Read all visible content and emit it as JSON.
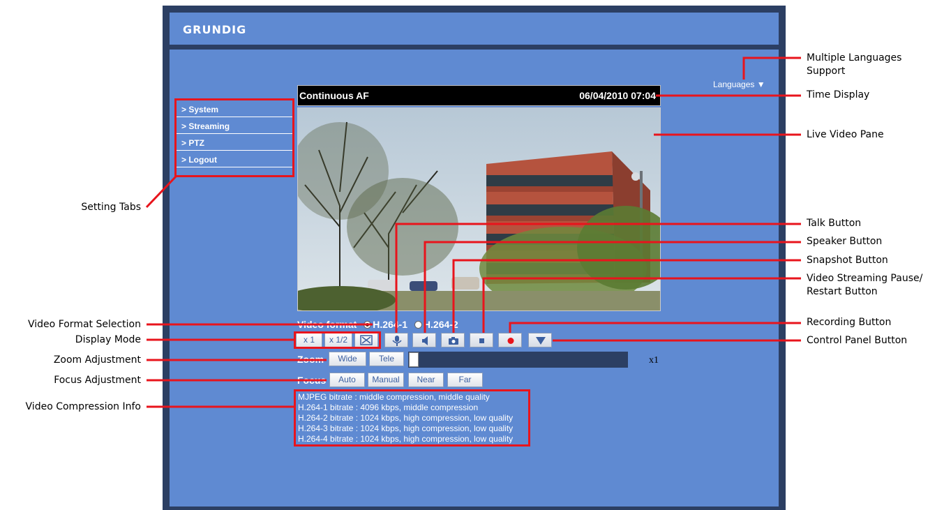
{
  "brand": "GRUNDIG",
  "languages_label": "Languages ▼",
  "tabs": [
    {
      "label": "> System"
    },
    {
      "label": "> Streaming"
    },
    {
      "label": "> PTZ"
    },
    {
      "label": "> Logout"
    }
  ],
  "video": {
    "mode": "Continuous AF",
    "timestamp": "06/04/2010 07:04"
  },
  "video_format": {
    "label": "Video format",
    "options": [
      "H.264-1",
      "H.264-2"
    ],
    "selected": "H.264-1"
  },
  "display_mode": {
    "x1": "x 1",
    "x_half": "x 1/2",
    "fullscreen_icon": "fullscreen-icon"
  },
  "toolbar_icons": [
    "microphone-icon",
    "speaker-icon",
    "camera-icon",
    "stop-icon",
    "record-icon",
    "triangle-down-icon"
  ],
  "zoom": {
    "label": "Zoom",
    "wide": "Wide",
    "tele": "Tele",
    "value": "x1",
    "level": 0
  },
  "focus": {
    "label": "Focus",
    "auto": "Auto",
    "manual": "Manual",
    "near": "Near",
    "far": "Far"
  },
  "compression_info": [
    "MJPEG bitrate : middle compression, middle quality",
    "H.264-1 bitrate : 4096 kbps, middle compression",
    "H.264-2 bitrate : 1024 kbps, high compression, low quality",
    "H.264-3 bitrate : 1024 kbps, high compression, low quality",
    "H.264-4 bitrate : 1024 kbps, high compression, low quality"
  ],
  "annotations": {
    "setting_tabs": "Setting Tabs",
    "video_format_selection": "Video Format Selection",
    "display_mode": "Display Mode",
    "zoom_adjustment": "Zoom Adjustment",
    "focus_adjustment": "Focus Adjustment",
    "video_compression_info": "Video Compression Info",
    "multiple_languages_1": "Multiple Languages",
    "multiple_languages_2": "Support",
    "time_display": "Time Display",
    "live_video_pane": "Live Video Pane",
    "talk_button": "Talk Button",
    "speaker_button": "Speaker Button",
    "snapshot_button": "Snapshot Button",
    "pause_restart_1": "Video Streaming Pause/",
    "pause_restart_2": "Restart Button",
    "recording_button": "Recording Button",
    "control_panel_button": "Control Panel Button"
  },
  "colors": {
    "panel": "#5f8ad2",
    "frame": "#2c3f63",
    "annotation_red": "#e8141c"
  }
}
